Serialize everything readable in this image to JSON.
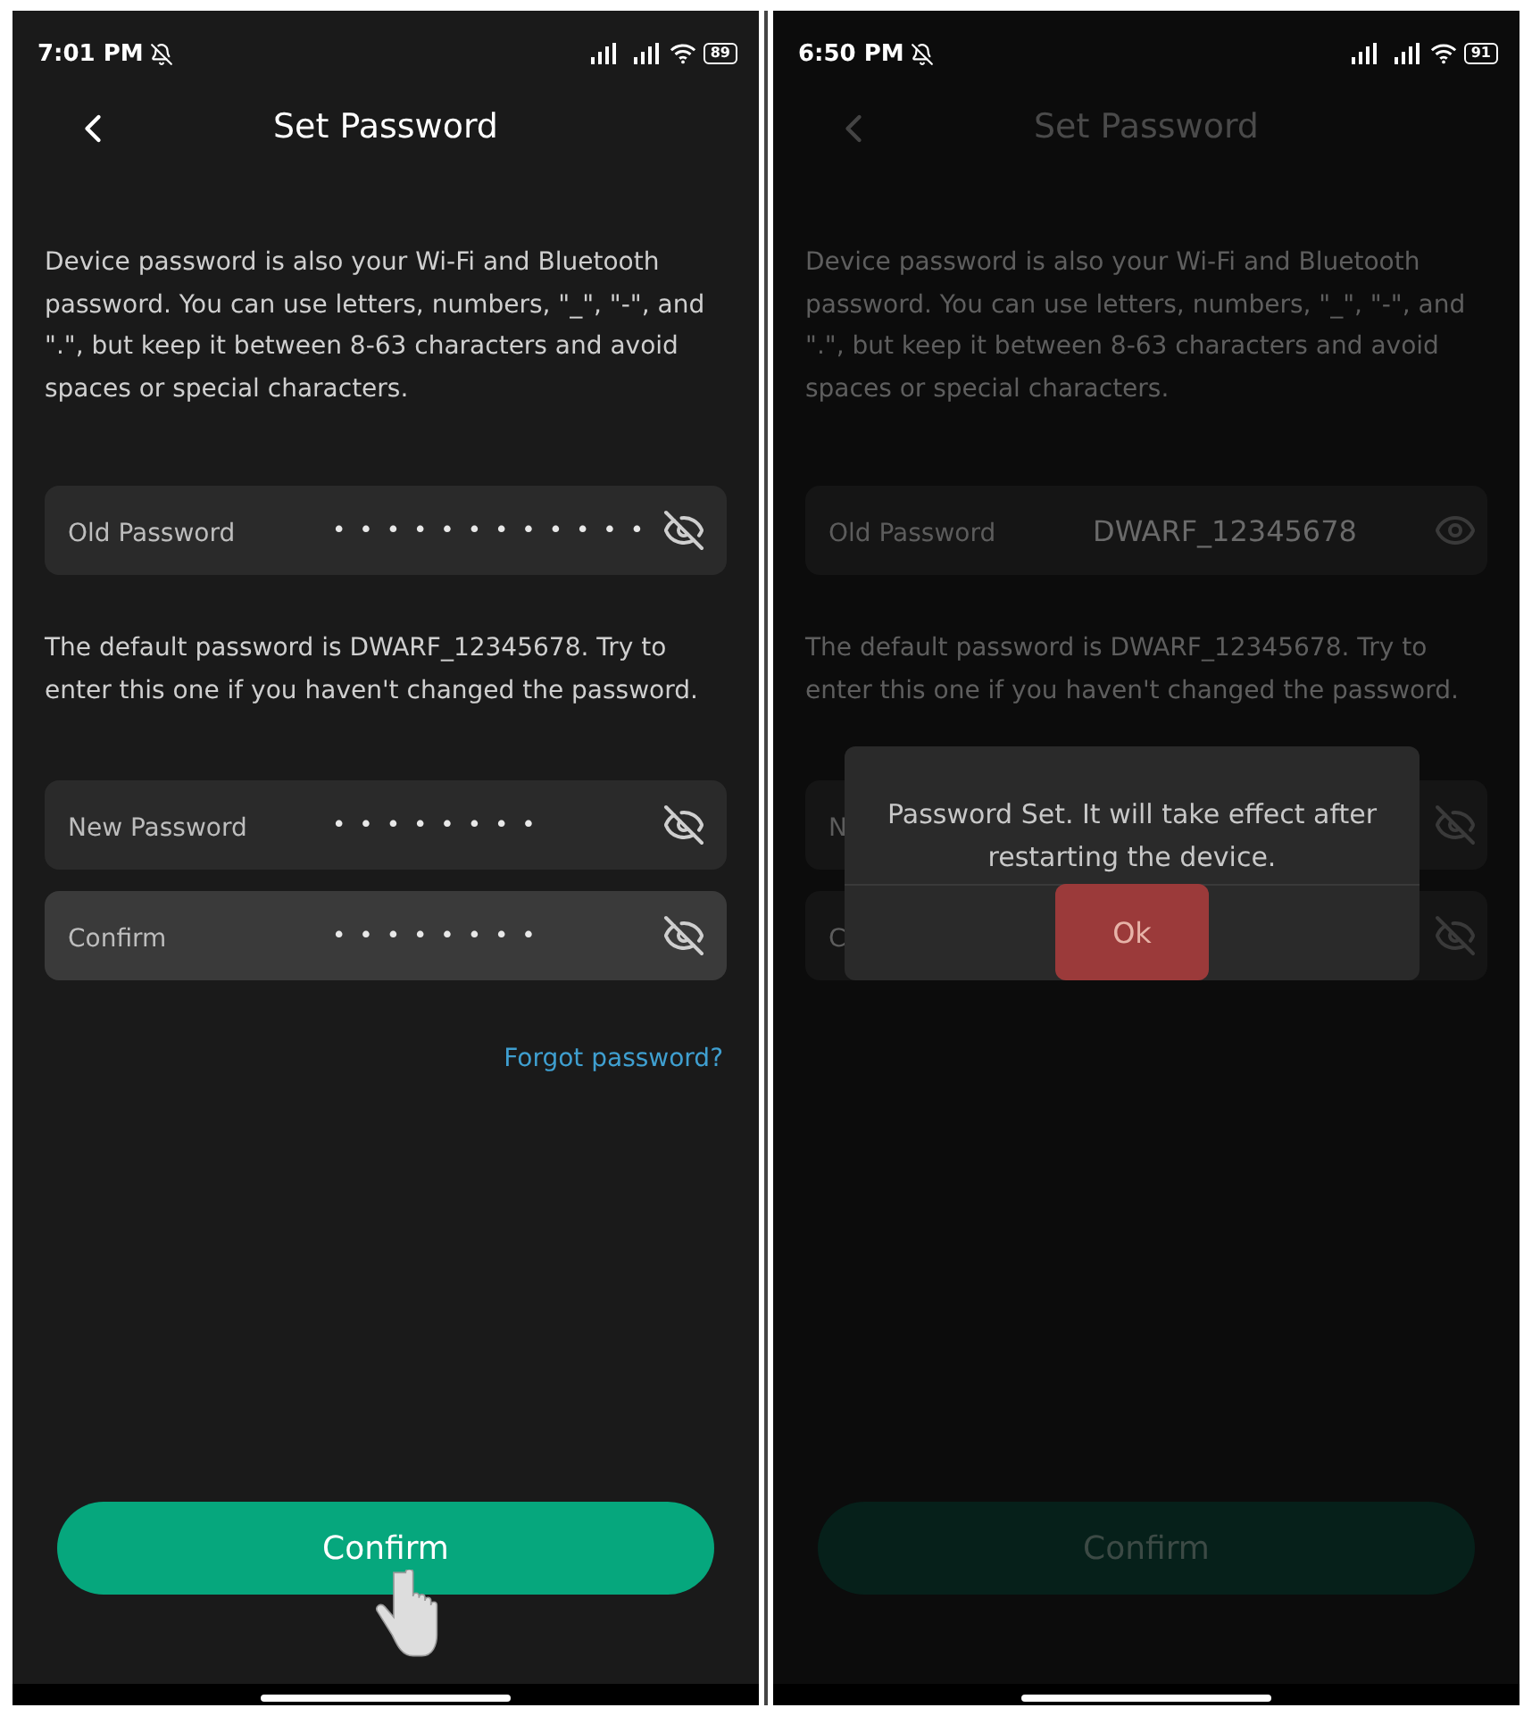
{
  "screens": [
    {
      "dimmed": false,
      "status_bar": {
        "time": "7:01 PM",
        "battery": "89"
      },
      "title": "Set Password",
      "intro": "Device password is also your Wi-Fi and Bluetooth password. You can use letters, numbers, \"_\", \"-\", and \".\", but keep it between 8-63 characters and avoid spaces or special characters.",
      "fields": [
        {
          "label": "Old Password",
          "value": "••••••••••••",
          "masked": true,
          "focused": false
        },
        {
          "label": "New Password",
          "value": "••••••••",
          "masked": true,
          "focused": false
        },
        {
          "label": "Confirm",
          "value": "••••••••",
          "masked": true,
          "focused": true
        }
      ],
      "hint": "The default password is DWARF_12345678. Try to enter this one if you haven't changed the password.",
      "forgot_link": "Forgot password?",
      "confirm_button": "Confirm",
      "tap_pointer": true
    },
    {
      "dimmed": true,
      "status_bar": {
        "time": "6:50 PM",
        "battery": "91"
      },
      "title": "Set Password",
      "intro": "Device password is also your Wi-Fi and Bluetooth password. You can use letters, numbers, \"_\", \"-\", and \".\", but keep it between 8-63 characters and avoid spaces or special characters.",
      "fields": [
        {
          "label": "Old Password",
          "value": "DWARF_12345678",
          "masked": false,
          "focused": false
        },
        {
          "label": "N",
          "masked": true,
          "focused": false
        },
        {
          "label": "C",
          "masked": true,
          "focused": false
        }
      ],
      "hint": "The default password is DWARF_12345678. Try to enter this one if you haven't changed the password.",
      "confirm_button": "Confirm",
      "tap_pointer": false,
      "dialog": {
        "message": "Password Set. It will take effect after restarting the device.",
        "button": "Ok"
      }
    }
  ]
}
